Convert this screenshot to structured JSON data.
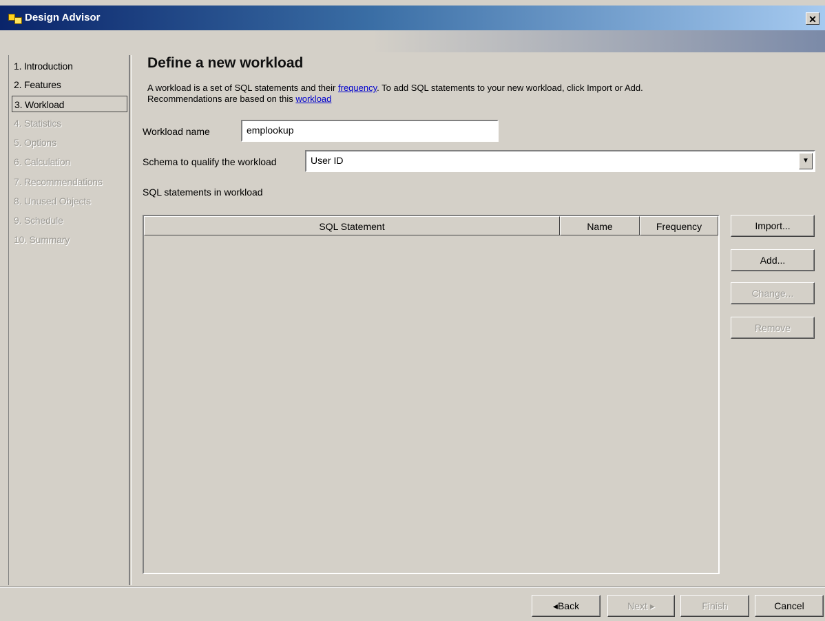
{
  "window": {
    "title": "Design Advisor",
    "close_label": "✕"
  },
  "sidebar": {
    "items": [
      {
        "label": "1. Introduction"
      },
      {
        "label": "2. Features"
      },
      {
        "label": "3. Workload"
      },
      {
        "label": "4. Statistics"
      },
      {
        "label": "5. Options"
      },
      {
        "label": "6. Calculation"
      },
      {
        "label": "7. Recommendations"
      },
      {
        "label": "8. Unused Objects"
      },
      {
        "label": "9. Schedule"
      },
      {
        "label": "10. Summary"
      }
    ]
  },
  "main": {
    "title": "Define a new workload",
    "desc": {
      "part1": "A workload is a set of SQL statements and their ",
      "link1": "frequency",
      "part2": ". To add SQL statements to your new workload, click Import or Add.",
      "part3": "Recommendations are based on this ",
      "link2": "workload"
    },
    "workload_name_label": "Workload name",
    "workload_name_value": "emplookup",
    "schema_label": "Schema to qualify the workload",
    "schema_value": "User ID",
    "sql_label": "SQL statements in workload",
    "table": {
      "columns": [
        "SQL Statement",
        "Name",
        "Frequency"
      ],
      "rows": []
    },
    "side_buttons": {
      "import": "Import...",
      "add": "Add...",
      "change": "Change...",
      "remove": "Remove"
    }
  },
  "footer": {
    "back": "◂Back",
    "next": "Next ▸",
    "finish": "Finish",
    "cancel": "Cancel"
  }
}
